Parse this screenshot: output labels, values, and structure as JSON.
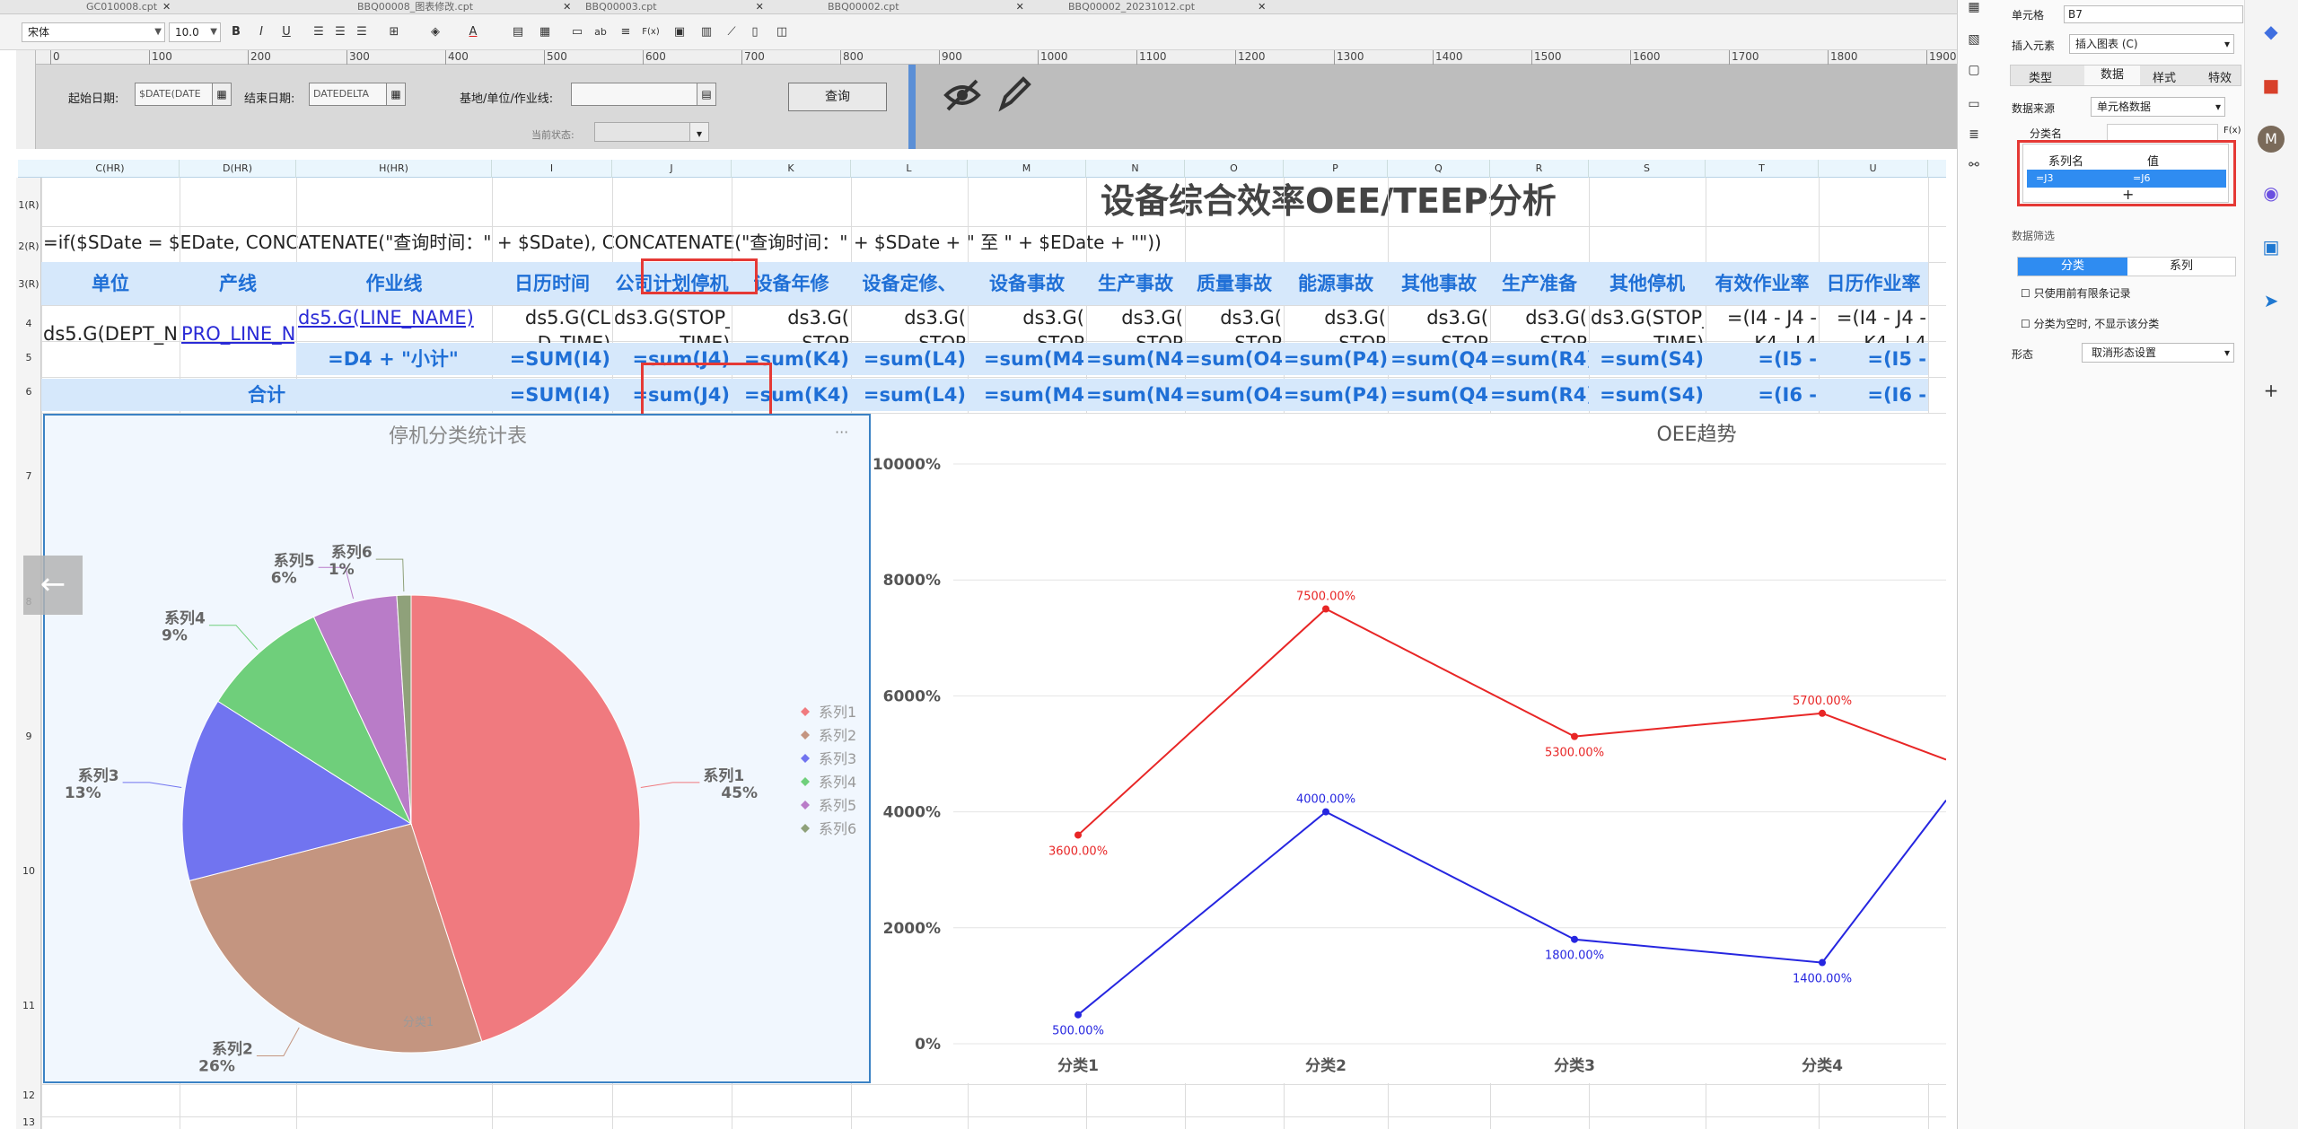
{
  "tabs": [
    "GC010008.cpt",
    "BBQ00008_图表修改.cpt",
    "BBQ00003.cpt",
    "BBQ00002.cpt",
    "BBQ00002_20231012.cpt"
  ],
  "toolbar": {
    "font": "宋体",
    "size": "10.0",
    "bold": "B",
    "italic": "I",
    "underline": "U",
    "text_ab": "ab",
    "fx": "F(x)"
  },
  "ruler_ticks": [
    "0",
    "100",
    "200",
    "300",
    "400",
    "500",
    "600",
    "700",
    "800",
    "900",
    "1000",
    "1100",
    "1200",
    "1300",
    "1400",
    "1500",
    "1600",
    "1700",
    "1800",
    "1900"
  ],
  "params": {
    "start_label": "起始日期:",
    "start_value": "$DATE(DATE",
    "end_label": "结束日期:",
    "end_value": "DATEDELTA",
    "base_label": "基地/单位/作业线:",
    "status_label": "当前状态:",
    "query": "查询"
  },
  "columns": [
    "C(HR)",
    "D(HR)",
    "H(HR)",
    "I",
    "J",
    "K",
    "L",
    "M",
    "N",
    "O",
    "P",
    "Q",
    "R",
    "S",
    "T",
    "U"
  ],
  "rows": [
    "1(R)",
    "2(R)",
    "3(R)",
    "4",
    "5",
    "6",
    "7",
    "8",
    "9",
    "10",
    "11",
    "12",
    "13"
  ],
  "sheet": {
    "title": "设备综合效率OEE/TEEP分析",
    "formula_row": "=if($SDate = $EDate, CONCATENATE(\"查询时间：\" + $SDate), CONCATENATE(\"查询时间：\" + $SDate + \" 至 \" + $EDate + \"\"))",
    "headers": [
      "单位",
      "产线",
      "作业线",
      "日历时间",
      "公司计划停机",
      "设备年修",
      "设备定修、",
      "设备事故",
      "生产事故",
      "质量事故",
      "能源事故",
      "其他事故",
      "生产准备",
      "其他停机",
      "有效作业率",
      "日历作业率"
    ],
    "row4": [
      "ds5.G(DEPT_NAME",
      "PRO_LINE_N",
      "ds5.G(LINE_NAME)",
      "ds5.G(CL",
      "ds3.G(STOP_",
      "ds3.G(",
      "ds3.G(",
      "ds3.G(",
      "ds3.G(",
      "ds3.G(",
      "ds3.G(",
      "ds3.G(",
      "ds3.G(",
      "ds3.G(STOP_",
      "=(I4 - J4 -",
      "=(I4 - J4 -"
    ],
    "row4b": [
      "D_TIME)",
      "TIME)",
      "STOP",
      "STOP",
      "STOP",
      "STOP",
      "STOP",
      "STOP",
      "STOP",
      "STOP",
      "TIME)",
      "K4 - L4",
      "K4 - L4"
    ],
    "row5": [
      "=D4 + \"小计\"",
      "=SUM(I4)",
      "=sum(J4)",
      "=sum(K4)",
      "=sum(L4)",
      "=sum(M4",
      "=sum(N4",
      "=sum(O4",
      "=sum(P4)",
      "=sum(Q4",
      "=sum(R4)",
      "=sum(S4)",
      "=(I5 -",
      "=(I5 -"
    ],
    "total_label": "合计",
    "row6": [
      "=SUM(I4)",
      "=sum(J4)",
      "=sum(K4)",
      "=sum(L4)",
      "=sum(M4",
      "=sum(N4",
      "=sum(O4",
      "=sum(P4)",
      "=sum(Q4",
      "=sum(R4)",
      "=sum(S4)",
      "=(I6 -",
      "=(I6 -"
    ]
  },
  "pie_chart": {
    "title": "停机分类统计表",
    "menu": "···",
    "category": "分类1"
  },
  "line_chart": {
    "title": "OEE趋势"
  },
  "chart_data": [
    {
      "type": "pie",
      "title": "停机分类统计表",
      "categories": [
        "系列1",
        "系列2",
        "系列3",
        "系列4",
        "系列5",
        "系列6"
      ],
      "values": [
        45,
        26,
        13,
        9,
        6,
        1
      ],
      "value_labels": [
        "45%",
        "26%",
        "13%",
        "9%",
        "6%",
        "1%"
      ],
      "colors": [
        "#f07a7f",
        "#c49580",
        "#7174f0",
        "#6fcf7b",
        "#b97cc8",
        "#8fa17a"
      ],
      "legend": "right",
      "xlabel": "分类1"
    },
    {
      "type": "line",
      "title": "OEE趋势",
      "categories": [
        "分类1",
        "分类2",
        "分类3",
        "分类4"
      ],
      "series": [
        {
          "values": [
            3600,
            7500,
            5300,
            5700
          ],
          "labels": [
            "3600.00%",
            "7500.00%",
            "5300.00%",
            "5700.00%"
          ],
          "color": "#e82626"
        },
        {
          "values": [
            500,
            4000,
            1800,
            1400
          ],
          "labels": [
            "500.00%",
            "4000.00%",
            "1800.00%",
            "1400.00%"
          ],
          "color": "#2626e0"
        }
      ],
      "ylim": [
        0,
        10000
      ],
      "yticks": [
        "0%",
        "2000%",
        "4000%",
        "6000%",
        "8000%",
        "10000%"
      ],
      "grid": true
    }
  ],
  "right_panel": {
    "cell_label": "单元格",
    "cell_value": "B7",
    "insert_label": "插入元素",
    "insert_value": "插入图表 (C)",
    "tabs": [
      "类型",
      "数据",
      "样式",
      "特效"
    ],
    "source_label": "数据来源",
    "source_value": "单元格数据",
    "category_label": "分类名",
    "fx": "F(x)",
    "series_name": "系列名",
    "value_col": "值",
    "series_val": "=J3",
    "value_val": "=J6",
    "add": "+",
    "filter_label": "数据筛选",
    "filter_tabs": [
      "分类",
      "系列"
    ],
    "use_prev": "只使用前有限条记录",
    "empty_hide": "分类为空时, 不显示该分类",
    "shape_label": "形态",
    "shape_value": "取消形态设置"
  }
}
